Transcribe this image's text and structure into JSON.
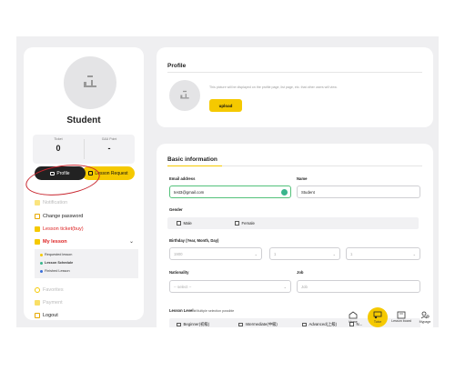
{
  "user": {
    "name": "Student",
    "stats": [
      {
        "label": "Ticket",
        "value": "0"
      },
      {
        "label": "G&U Point",
        "value": "-"
      }
    ]
  },
  "sidebar": {
    "profile_button": "Profile",
    "lesson_request_button": "Lesson Request",
    "items": [
      {
        "label": "Notification"
      },
      {
        "label": "Change password"
      },
      {
        "label": "Lesson ticket(buy)"
      },
      {
        "label": "My lesson"
      },
      {
        "label": "Favorites"
      },
      {
        "label": "Payment"
      },
      {
        "label": "Logout"
      }
    ],
    "my_lesson_sub": [
      {
        "label": "Requested lesson"
      },
      {
        "label": "Lesson Schedule"
      },
      {
        "label": "Finished Lesson"
      }
    ]
  },
  "profile_section": {
    "title": "Profile",
    "note": "This picture will be displayed on the profile page, list page, etc. that other users will view.",
    "upload_label": "upload"
  },
  "basic_info": {
    "title": "Basic information",
    "email_label": "Email address",
    "email_value": "test3@gmail.com",
    "name_label": "Name",
    "name_value": "Student",
    "gender_label": "Gender",
    "gender_options": [
      "Male",
      "Female"
    ],
    "birthday_label": "Birthday (Year, Month, Day)",
    "birth_year": "1900",
    "birth_month": "1",
    "birth_day": "1",
    "nationality_label": "Nationality",
    "nationality_value": "-- select --",
    "job_label": "Job",
    "job_placeholder": "Job",
    "lesson_level_label": "Lesson Level",
    "lesson_level_note": "※Multiple selection possible",
    "lesson_levels": [
      "Beginner(初級)",
      "Intermediate(中級)",
      "Advanced(上級)",
      "N..."
    ]
  },
  "bottom_nav": [
    {
      "label": "Home",
      "icon": "home-icon"
    },
    {
      "label": "Tutor",
      "icon": "tutor-icon"
    },
    {
      "label": "Lesson board",
      "icon": "board-icon"
    },
    {
      "label": "Mypage",
      "icon": "mypage-icon"
    }
  ],
  "colors": {
    "accent": "#f5c900",
    "dark": "#222222",
    "annotation": "#c8252e",
    "success": "#39b58c"
  }
}
